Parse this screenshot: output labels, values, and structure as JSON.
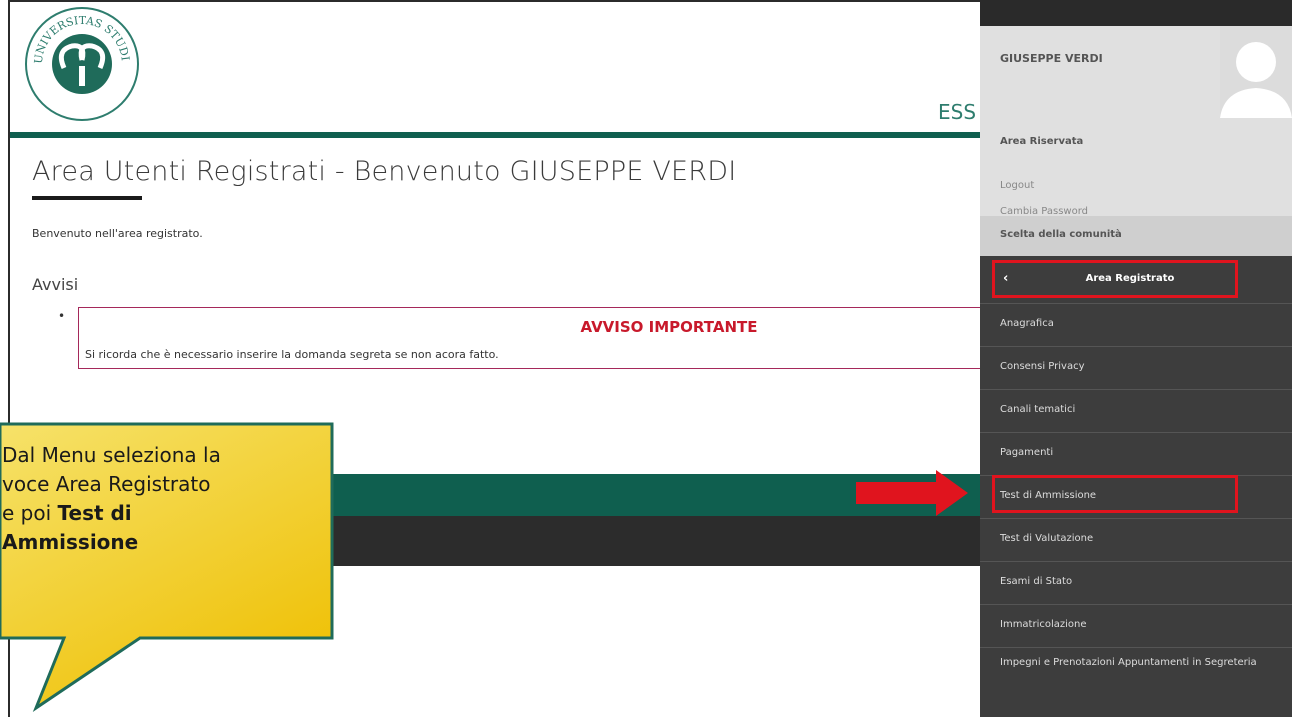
{
  "header": {
    "ess_text": "ESS"
  },
  "main": {
    "title": "Area Utenti Registrati - Benvenuto GIUSEPPE VERDI",
    "welcome": "Benvenuto nell'area registrato.",
    "avvisi_heading": "Avvisi",
    "notice": {
      "title": "AVVISO IMPORTANTE",
      "text": "Si ricorda che è necessario inserire la domanda segreta se non acora fatto."
    }
  },
  "sidebar": {
    "username": "GIUSEPPE VERDI",
    "area_riservata": "Area Riservata",
    "logout": "Logout",
    "cambia_password": "Cambia Password",
    "scelta": "Scelta della comunità",
    "section_title": "Area Registrato",
    "items": [
      {
        "label": "Anagrafica"
      },
      {
        "label": "Consensi Privacy"
      },
      {
        "label": "Canali tematici"
      },
      {
        "label": "Pagamenti"
      },
      {
        "label": "Test di Ammissione"
      },
      {
        "label": "Test di Valutazione"
      },
      {
        "label": "Esami di Stato"
      },
      {
        "label": "Immatricolazione"
      },
      {
        "label": "Impegni e Prenotazioni Appuntamenti in Segreteria"
      }
    ]
  },
  "callout": {
    "line1": "Dal Menu seleziona la",
    "line2": "voce Area Registrato",
    "line3_plain": "e poi ",
    "line3_bold": "Test di",
    "line4_bold": "Ammissione"
  },
  "colors": {
    "brand_green": "#0f5f4f",
    "highlight_red": "#e0141e",
    "callout_yellow": "#f3d21e"
  }
}
